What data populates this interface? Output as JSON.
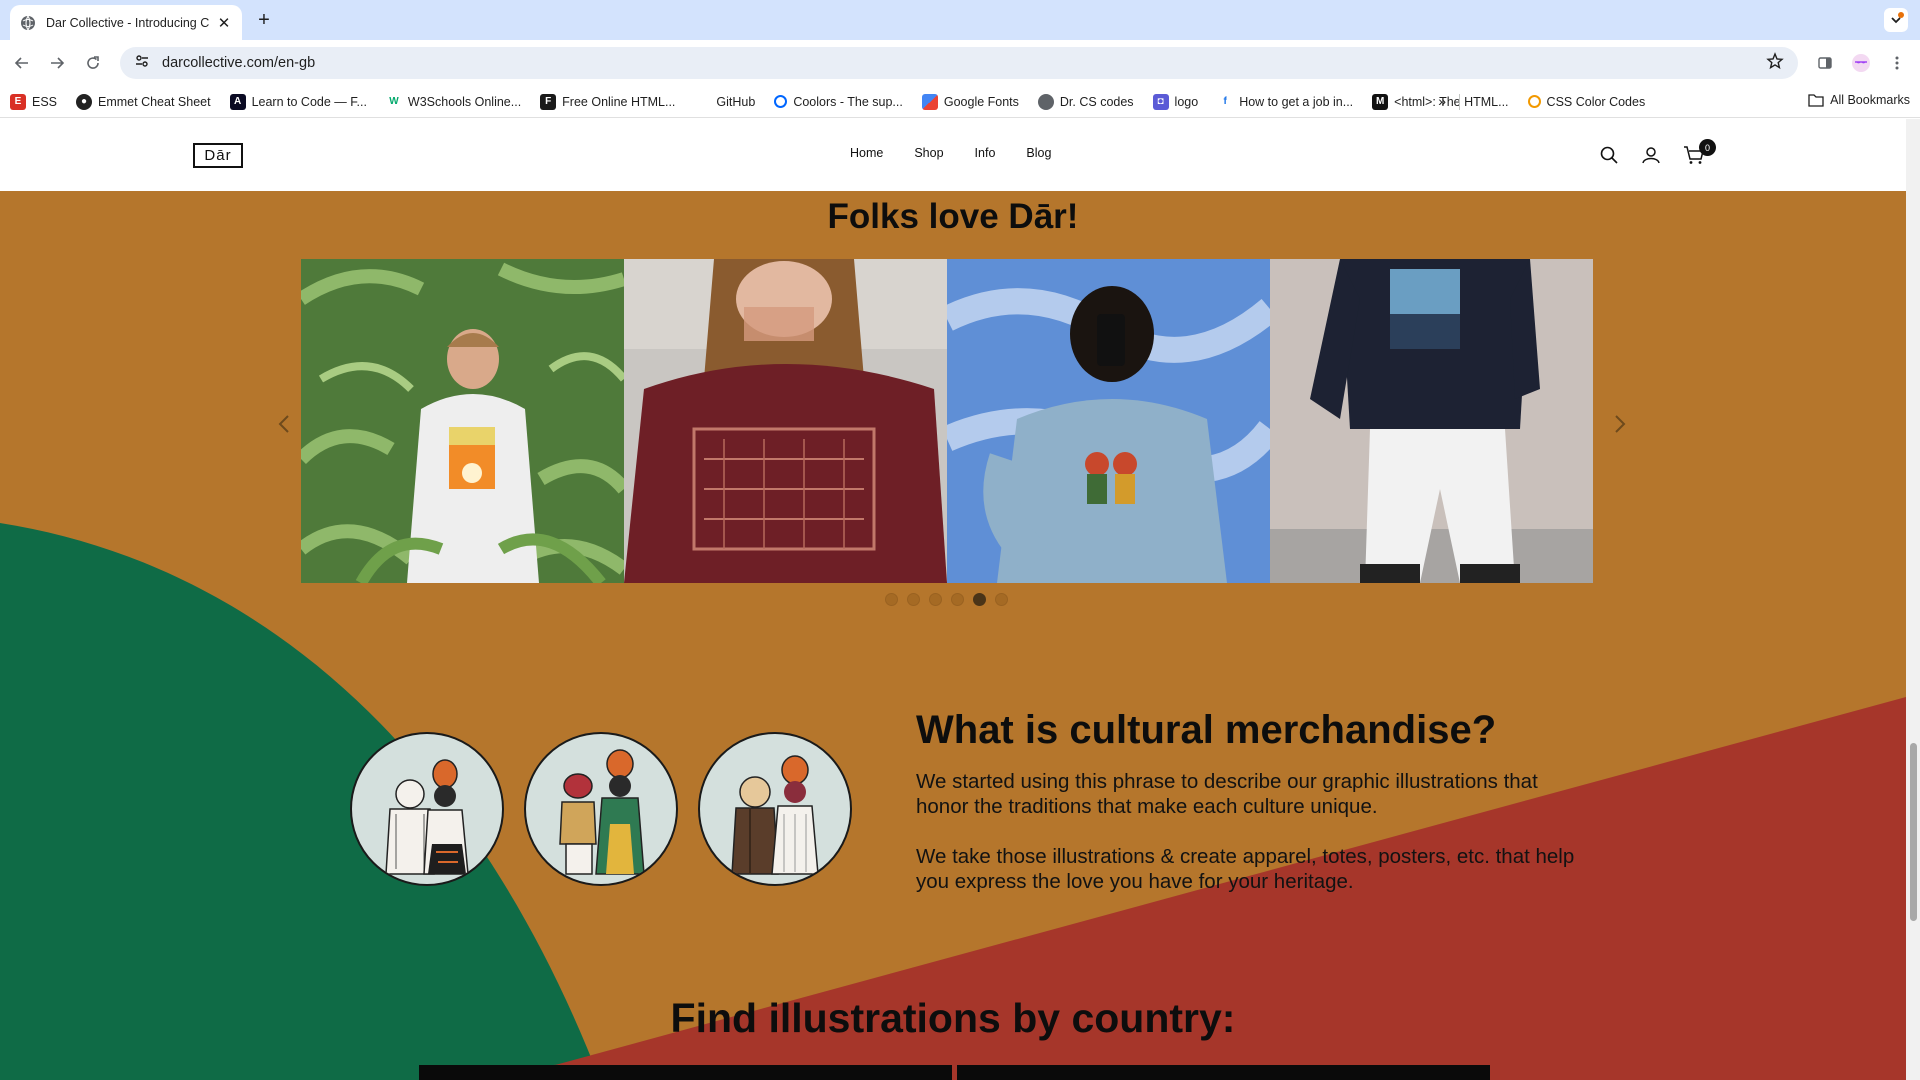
{
  "browser": {
    "tab_title": "Dar Collective - Introducing C",
    "url": "darcollective.com/en-gb",
    "bookmarks": [
      {
        "label": "ESS",
        "color": "#d93025"
      },
      {
        "label": "Emmet Cheat Sheet",
        "color": "#222222"
      },
      {
        "label": "Learn to Code — F...",
        "color": "#0a0a23"
      },
      {
        "label": "W3Schools Online...",
        "color": "#04aa6d"
      },
      {
        "label": "Free Online HTML...",
        "color": "#1a1a1a"
      },
      {
        "label": "GitHub",
        "color": "#ffffff"
      },
      {
        "label": "Coolors - The sup...",
        "color": "#0066ff"
      },
      {
        "label": "Google Fonts",
        "color": "#4285f4"
      },
      {
        "label": "Dr. CS codes",
        "color": "#5f6368"
      },
      {
        "label": "logo",
        "color": "#5b5bd6"
      },
      {
        "label": "How to get a job in...",
        "color": "#1a73e8"
      },
      {
        "label": "<html>: The HTML...",
        "color": "#111111"
      },
      {
        "label": "CSS Color Codes",
        "color": "#f29900"
      }
    ],
    "all_bookmarks": "All Bookmarks"
  },
  "site": {
    "logo": "Dār",
    "nav": [
      "Home",
      "Shop",
      "Info",
      "Blog"
    ],
    "cart_count": "0"
  },
  "folks": {
    "title": "Folks love Dār!",
    "photos": [
      "photo-fern-sweatshirt",
      "photo-maroon-sweatshirt",
      "photo-blue-sweatshirt",
      "photo-black-sweatshirt"
    ],
    "dots_total": 6,
    "dot_active_index": 4
  },
  "merch": {
    "title": "What is cultural merchandise?",
    "para1": "We started using this phrase to describe our graphic illustrations that honor the traditions that make each culture unique.",
    "para2": "We take those illustrations & create apparel, totes, posters, etc. that help you express the love you have for your heritage."
  },
  "find": {
    "title": "Find illustrations by country:"
  },
  "colors": {
    "mustard": "#b5762c",
    "green": "#0f6b46",
    "red": "#a6362a"
  }
}
